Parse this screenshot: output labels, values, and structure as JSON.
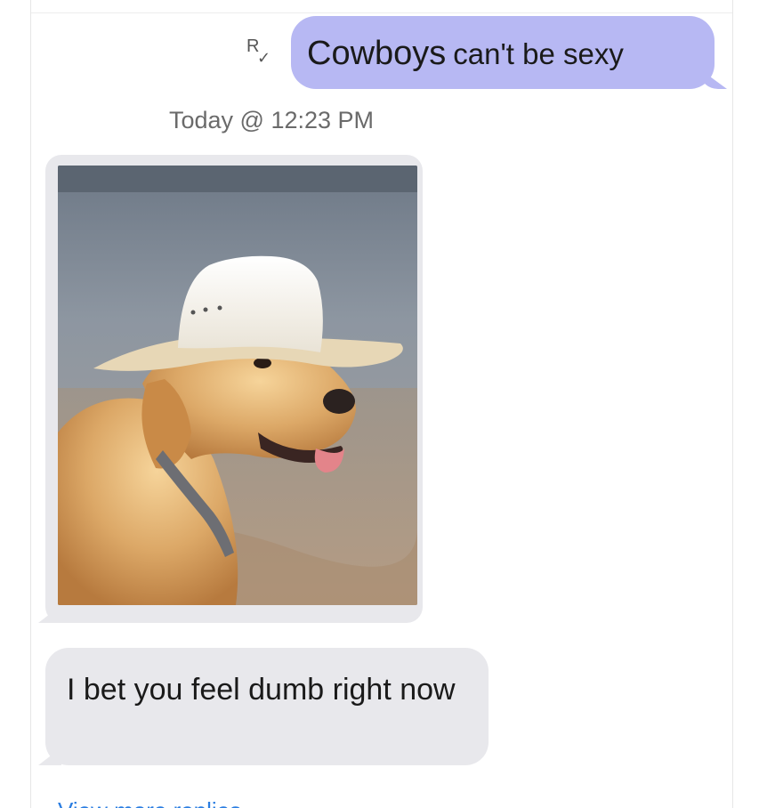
{
  "conversation": {
    "sent_message": {
      "words": [
        "Cowboys",
        "can't be sexy"
      ],
      "read_indicator": {
        "icon": "read-receipt-icon",
        "letter": "R",
        "mark": "✓"
      },
      "bubble_color": "#b7b8f3"
    },
    "timestamp": "Today @ 12:23 PM",
    "received_image": {
      "description_icon": "photo-dog-in-cowboy-hat"
    },
    "received_message": {
      "text": "I bet you feel dumb right now"
    },
    "received_bubble_color": "#e8e8ec"
  },
  "footer": {
    "link_text": "View more replies"
  }
}
